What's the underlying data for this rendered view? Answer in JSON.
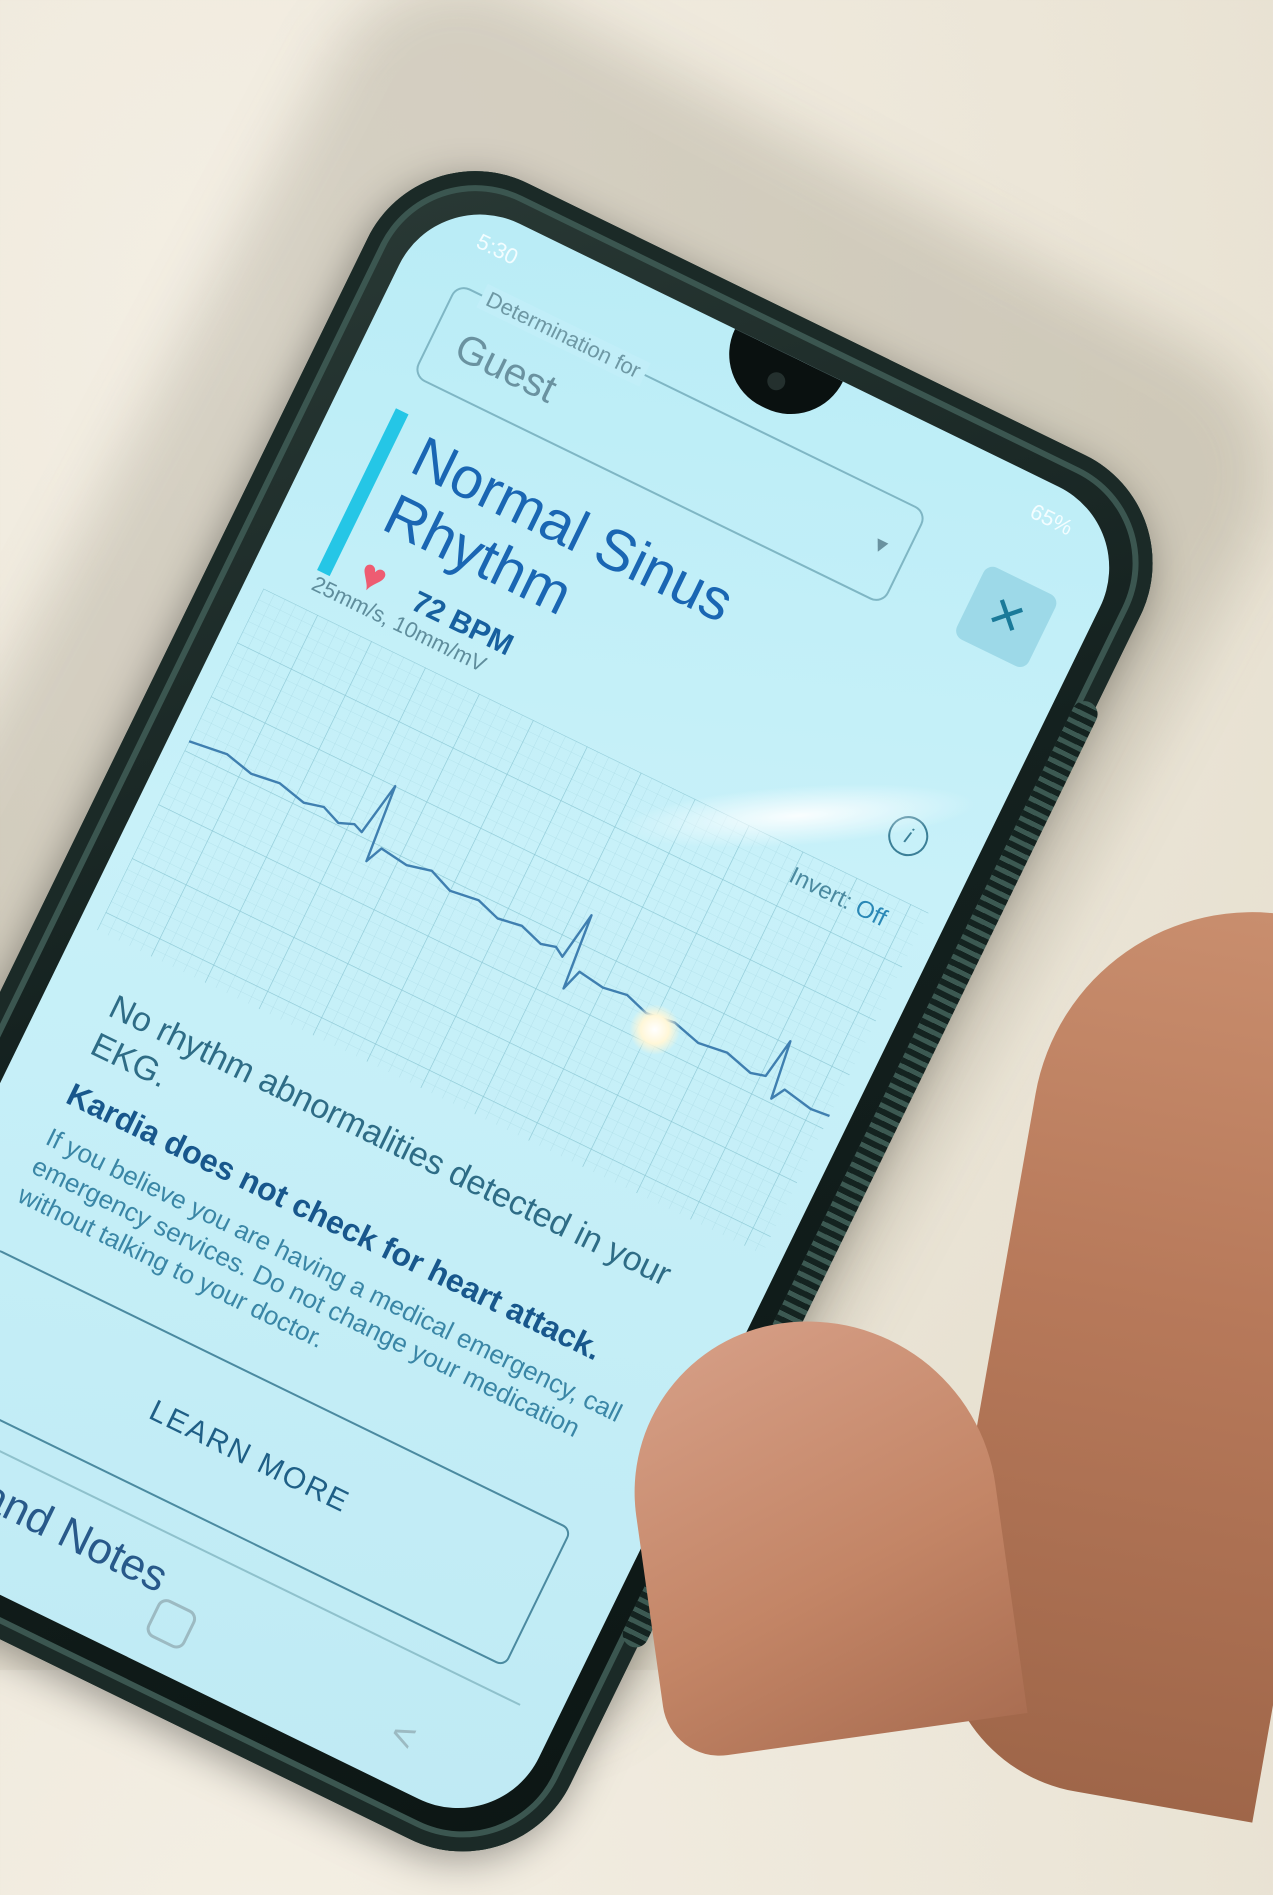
{
  "status": {
    "time": "5:30",
    "battery": "65%"
  },
  "determination": {
    "label": "Determination for",
    "value": "Guest",
    "chevron": "chevron-down-icon"
  },
  "result": {
    "title": "Normal Sinus Rhythm",
    "bpm": "72 BPM",
    "heart_icon": "heart-icon"
  },
  "ekg": {
    "scale": "25mm/s, 10mm/mV",
    "invert_label": "Invert:",
    "invert_value": "Off"
  },
  "message": {
    "abnormalities": "No rhythm abnormalities detected in your EKG.",
    "warning": "Kardia does not check for heart attack.",
    "advice": "If you believe you are having a medical emergency, call emergency services. Do not change your medication without talking to your doctor."
  },
  "learn_more": "LEARN MORE",
  "tags_heading": "Tags and Notes",
  "close_icon": "close-icon",
  "info_icon": "info-icon",
  "colors": {
    "screen_bg": "#c8f1f9",
    "accent_bar": "#25c6e6",
    "title_blue": "#1a66b3",
    "heart": "#ee5c72"
  }
}
